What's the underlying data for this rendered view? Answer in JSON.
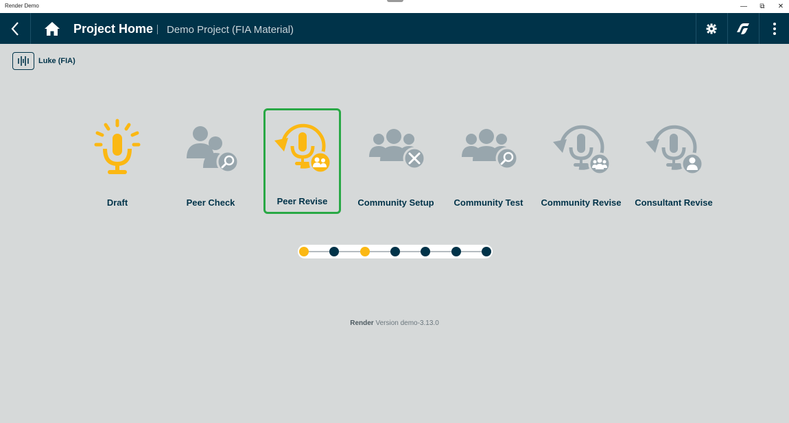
{
  "window": {
    "title": "Render Demo",
    "min_glyph": "—",
    "max_glyph": "⧉",
    "close_glyph": "✕"
  },
  "header": {
    "title": "Project Home",
    "project": "Demo Project (FIA Material)"
  },
  "user": {
    "name": "Luke (FIA)"
  },
  "steps": [
    {
      "label": "Draft",
      "icon": "lightbulb-mic-icon",
      "state": "active"
    },
    {
      "label": "Peer Check",
      "icon": "peer-check-icon",
      "state": "inactive"
    },
    {
      "label": "Peer Revise",
      "icon": "peer-revise-icon",
      "state": "active-selected"
    },
    {
      "label": "Community Setup",
      "icon": "community-setup-icon",
      "state": "inactive"
    },
    {
      "label": "Community Test",
      "icon": "community-test-icon",
      "state": "inactive"
    },
    {
      "label": "Community Revise",
      "icon": "community-revise-icon",
      "state": "inactive"
    },
    {
      "label": "Consultant Revise",
      "icon": "consultant-revise-icon",
      "state": "inactive"
    }
  ],
  "progress": {
    "dots": [
      "complete",
      "pending",
      "complete",
      "pending",
      "pending",
      "pending",
      "pending"
    ]
  },
  "version": {
    "app": "Render",
    "text": "Version demo-3.13.0"
  },
  "colors": {
    "header_bg": "#003349",
    "accent": "#fbb813",
    "inactive_icon": "#98a6ad",
    "selected_border": "#29a845",
    "dot_pending": "#003349"
  }
}
